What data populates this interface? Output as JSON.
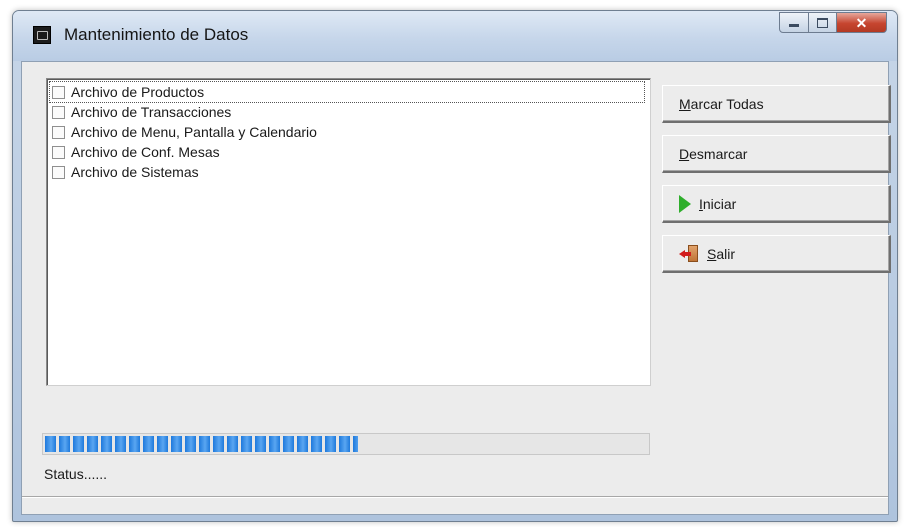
{
  "window": {
    "title": "Mantenimiento de Datos",
    "app_icon": "app-window-icon",
    "caption_buttons": {
      "minimize": "minimize-icon",
      "maximize": "maximize-icon",
      "close": "close-icon"
    }
  },
  "file_list": {
    "items": [
      {
        "label": "Archivo de Productos",
        "checked": false,
        "focused": true
      },
      {
        "label": "Archivo de Transacciones",
        "checked": false,
        "focused": false
      },
      {
        "label": "Archivo de Menu, Pantalla y Calendario",
        "checked": false,
        "focused": false
      },
      {
        "label": "Archivo de Conf. Mesas",
        "checked": false,
        "focused": false
      },
      {
        "label": "Archivo de Sistemas",
        "checked": false,
        "focused": false
      }
    ]
  },
  "buttons": {
    "mark_all": {
      "mnemonic": "M",
      "rest": "arcar Todas"
    },
    "unmark": {
      "mnemonic": "D",
      "rest": "esmarcar"
    },
    "start": {
      "mnemonic": "I",
      "rest": "niciar",
      "icon": "play-icon"
    },
    "exit": {
      "mnemonic": "S",
      "rest": "alir",
      "icon": "exit-door-icon"
    }
  },
  "progress": {
    "fraction": 0.52
  },
  "status": {
    "text": "Status......"
  },
  "colors": {
    "progress_blue": "#1e79dc",
    "start_icon_green": "#2fae2c",
    "close_red": "#c6452f"
  }
}
